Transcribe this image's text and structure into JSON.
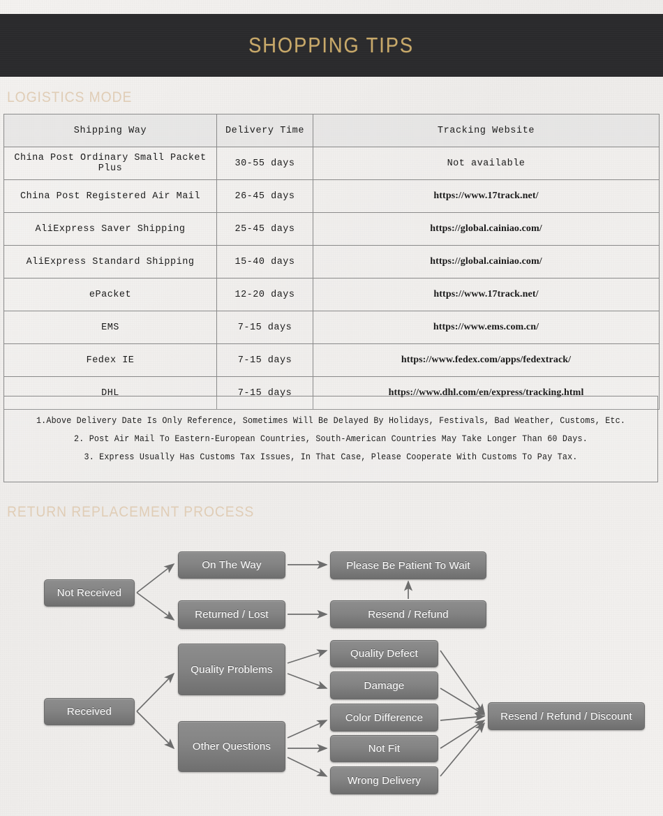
{
  "header": {
    "title": "SHOPPING TIPS",
    "accent_color": "#c8a96a",
    "bar_color": "#2b2b2d"
  },
  "sections": {
    "logistics_title": "LOGISTICS MODE",
    "return_title": "RETURN REPLACEMENT PROCESS",
    "title_color": "#e0cdb6"
  },
  "logistics_table": {
    "columns": [
      "Shipping Way",
      "Delivery Time",
      "Tracking Website"
    ],
    "rows": [
      {
        "way": "China Post Ordinary Small Packet Plus",
        "time": "30-55 days",
        "site": "Not available",
        "site_is_url": false
      },
      {
        "way": "China Post Registered Air Mail",
        "time": "26-45 days",
        "site": "https://www.17track.net/",
        "site_is_url": true
      },
      {
        "way": "AliExpress Saver Shipping",
        "time": "25-45 days",
        "site": "https://global.cainiao.com/",
        "site_is_url": true
      },
      {
        "way": "AliExpress Standard Shipping",
        "time": "15-40 days",
        "site": "https://global.cainiao.com/",
        "site_is_url": true
      },
      {
        "way": "ePacket",
        "time": "12-20 days",
        "site": "https://www.17track.net/",
        "site_is_url": true
      },
      {
        "way": "EMS",
        "time": "7-15 days",
        "site": "https://www.ems.com.cn/",
        "site_is_url": true
      },
      {
        "way": "Fedex IE",
        "time": "7-15 days",
        "site": "https://www.fedex.com/apps/fedextrack/",
        "site_is_url": true
      },
      {
        "way": "DHL",
        "time": "7-15 days",
        "site": "https://www.dhl.com/en/express/tracking.html",
        "site_is_url": true
      }
    ]
  },
  "notes": [
    "1.Above Delivery Date Is Only Reference, Sometimes Will Be Delayed By Holidays, Festivals, Bad Weather, Customs, Etc.",
    "2. Post Air Mail To Eastern-European Countries, South-American Countries May Take Longer Than 60 Days.",
    "3. Express Usually Has Customs Tax Issues, In That Case, Please Cooperate With Customs To Pay Tax."
  ],
  "flowchart": {
    "node_fill": "#848484",
    "arrow_color": "#6d6d6d",
    "nodes": {
      "not_received": "Not Received",
      "received": "Received",
      "on_the_way": "On The Way",
      "returned_lost": "Returned / Lost",
      "quality_problems": "Quality Problems",
      "other_questions": "Other Questions",
      "please_wait": "Please Be Patient To Wait",
      "resend_refund": "Resend / Refund",
      "quality_defect": "Quality Defect",
      "damage": "Damage",
      "color_difference": "Color Difference",
      "not_fit": "Not Fit",
      "wrong_delivery": "Wrong Delivery",
      "resend_refund_discount": "Resend / Refund / Discount"
    }
  }
}
